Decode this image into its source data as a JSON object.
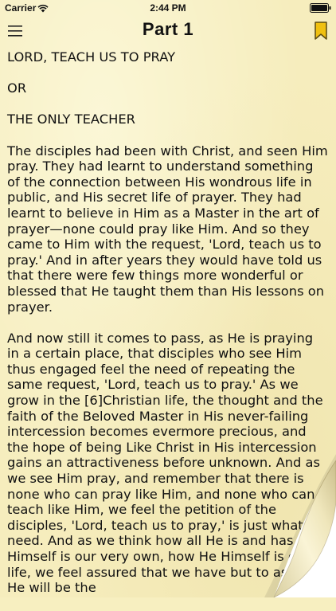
{
  "status_bar": {
    "carrier": "Carrier",
    "time": "2:44 PM"
  },
  "nav": {
    "title": "Part 1",
    "menu_icon": "hamburger-menu-icon",
    "bookmark_icon": "bookmark-icon",
    "bookmark_color": "#e8b400"
  },
  "content": {
    "heading1": "LORD, TEACH US TO PRAY",
    "heading2": "OR",
    "heading3": "THE ONLY TEACHER",
    "paragraph1": "The disciples had been with Christ, and seen Him pray. They had learnt to understand something of the connection between His wondrous life in public, and His secret life of prayer. They had learnt to believe in Him as a Master in the art of prayer—none could pray like Him. And so they came to Him with the request, 'Lord, teach us to pray.' And in after years they would have told us that there were few things more wonderful or blessed that He taught them than His lessons on prayer.",
    "paragraph2": "And now still it comes to pass, as He is praying in a certain place, that disciples who see Him thus engaged feel the need of repeating the same request, 'Lord, teach us to pray.' As we grow in the [6]Christian life, the thought and the faith of the Beloved Master in His never-failing intercession becomes evermore precious, and the hope of being Like Christ in His intercession gains an attractiveness before unknown. And as we see Him pray, and remember that there is none who can pray like Him, and none who can teach like Him, we feel the petition of the disciples, 'Lord, teach us to pray,' is just what we need. And as we think how all He is and has, He Himself is our very own, how He Himself is our life, we feel assured that we have but to ask, and He will be the"
  }
}
